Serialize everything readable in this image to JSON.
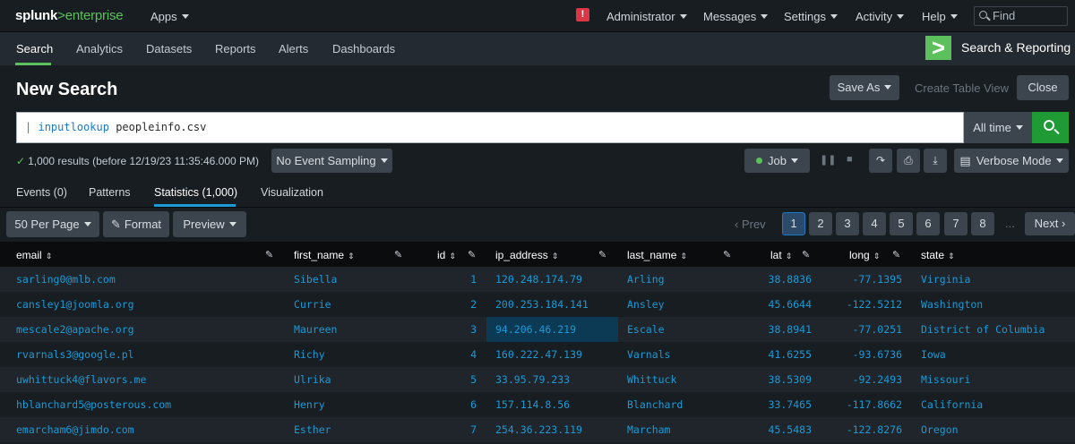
{
  "topbar": {
    "logo_main": "splunk",
    "logo_gt": ">",
    "logo_product": "enterprise",
    "apps_label": "Apps",
    "alert_glyph": "!",
    "nav": [
      "Administrator",
      "Messages",
      "Settings",
      "Activity",
      "Help"
    ],
    "find_placeholder": "Find"
  },
  "appnav": {
    "items": [
      "Search",
      "Analytics",
      "Datasets",
      "Reports",
      "Alerts",
      "Dashboards"
    ],
    "active": "Search",
    "app_logo_glyph": ">",
    "app_name": "Search & Reporting",
    "accent_color": "#5cc05c"
  },
  "header": {
    "title": "New Search",
    "save_as": "Save As",
    "create_table_view": "Create Table View",
    "close": "Close"
  },
  "search": {
    "pipe": "|",
    "command": "inputlookup",
    "argument": "peopleinfo.csv",
    "time_range": "All time"
  },
  "status": {
    "results_text": "1,000 results (before 12/19/23 11:35:46.000 PM)",
    "sampling": "No Event Sampling",
    "job": "Job",
    "mode": "Verbose Mode"
  },
  "tabs": [
    "Events (0)",
    "Patterns",
    "Statistics (1,000)",
    "Visualization"
  ],
  "active_tab": "Statistics (1,000)",
  "table_controls": {
    "per_page": "50 Per Page",
    "format": "Format",
    "preview": "Preview",
    "prev": "Prev",
    "pages": [
      "1",
      "2",
      "3",
      "4",
      "5",
      "6",
      "7",
      "8"
    ],
    "current_page": "1",
    "ellipsis": "...",
    "next": "Next"
  },
  "table": {
    "columns": [
      "email",
      "first_name",
      "id",
      "ip_address",
      "last_name",
      "lat",
      "long",
      "state"
    ],
    "rows": [
      [
        "sarling0@mlb.com",
        "Sibella",
        "1",
        "120.248.174.79",
        "Arling",
        "38.8836",
        "-77.1395",
        "Virginia"
      ],
      [
        "cansley1@joomla.org",
        "Currie",
        "2",
        "200.253.184.141",
        "Ansley",
        "45.6644",
        "-122.5212",
        "Washington"
      ],
      [
        "mescale2@apache.org",
        "Maureen",
        "3",
        "94.206.46.219",
        "Escale",
        "38.8941",
        "-77.0251",
        "District of Columbia"
      ],
      [
        "rvarnals3@google.pl",
        "Richy",
        "4",
        "160.222.47.139",
        "Varnals",
        "41.6255",
        "-93.6736",
        "Iowa"
      ],
      [
        "uwhittuck4@flavors.me",
        "Ulrika",
        "5",
        "33.95.79.233",
        "Whittuck",
        "38.5309",
        "-92.2493",
        "Missouri"
      ],
      [
        "hblanchard5@posterous.com",
        "Henry",
        "6",
        "157.114.8.56",
        "Blanchard",
        "33.7465",
        "-117.8662",
        "California"
      ],
      [
        "emarcham6@jimdo.com",
        "Esther",
        "7",
        "254.36.223.119",
        "Marcham",
        "45.5483",
        "-122.8276",
        "Oregon"
      ]
    ],
    "highlighted_cell": {
      "row": 2,
      "column": "ip_address"
    },
    "link_color": "#1a9ad6"
  }
}
